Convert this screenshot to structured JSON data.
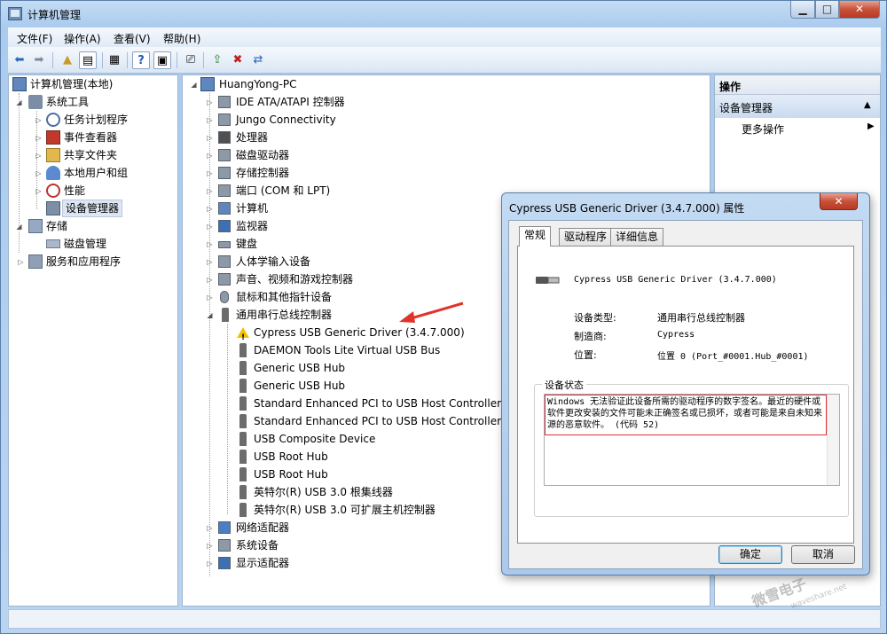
{
  "window": {
    "title": "计算机管理"
  },
  "caption_buttons": {
    "minimize": "▁",
    "maximize": "□",
    "close": "✕"
  },
  "menu": [
    "文件(F)",
    "操作(A)",
    "查看(V)",
    "帮助(H)"
  ],
  "tree_left": {
    "root": "计算机管理(本地)",
    "system_tools": "系统工具",
    "task_scheduler": "任务计划程序",
    "event_viewer": "事件查看器",
    "shared_folders": "共享文件夹",
    "local_users": "本地用户和组",
    "performance": "性能",
    "device_manager": "设备管理器",
    "storage": "存储",
    "disk_management": "磁盘管理",
    "services_apps": "服务和应用程序"
  },
  "devices": {
    "computer_name": "HuangYong-PC",
    "categories": [
      "IDE ATA/ATAPI 控制器",
      "Jungo Connectivity",
      "处理器",
      "磁盘驱动器",
      "存储控制器",
      "端口 (COM 和 LPT)",
      "计算机",
      "监视器",
      "键盘",
      "人体学输入设备",
      "声音、视频和游戏控制器",
      "鼠标和其他指针设备",
      "通用串行总线控制器"
    ],
    "usb_children": [
      "Cypress USB Generic Driver (3.4.7.000)",
      "DAEMON Tools Lite Virtual USB Bus",
      "Generic USB Hub",
      "Generic USB Hub",
      "Standard Enhanced PCI to USB Host Controller",
      "Standard Enhanced PCI to USB Host Controller",
      "USB Composite Device",
      "USB Root Hub",
      "USB Root Hub",
      "英特尔(R) USB 3.0 根集线器",
      "英特尔(R) USB 3.0 可扩展主机控制器"
    ],
    "after_categories": [
      "网络适配器",
      "系统设备",
      "显示适配器"
    ]
  },
  "actions": {
    "header": "操作",
    "section": "设备管理器",
    "more": "更多操作"
  },
  "dialog": {
    "title": "Cypress USB Generic Driver (3.4.7.000) 属性",
    "close": "✕",
    "tabs": [
      "常规",
      "驱动程序",
      "详细信息"
    ],
    "device_name": "Cypress USB Generic Driver (3.4.7.000)",
    "type_label": "设备类型:",
    "type_value": "通用串行总线控制器",
    "manufacturer_label": "制造商:",
    "manufacturer_value": "Cypress",
    "location_label": "位置:",
    "location_value": "位置 0 (Port_#0001.Hub_#0001)",
    "status_legend": "设备状态",
    "status_text": "Windows 无法验证此设备所需的驱动程序的数字签名。最近的硬件或软件更改安装的文件可能未正确签名或已损坏，或者可能是来自未知来源的恶意软件。 (代码 52)",
    "ok": "确定",
    "cancel": "取消"
  },
  "watermark": {
    "brand": "微雪电子",
    "site": "waveshare.net"
  }
}
